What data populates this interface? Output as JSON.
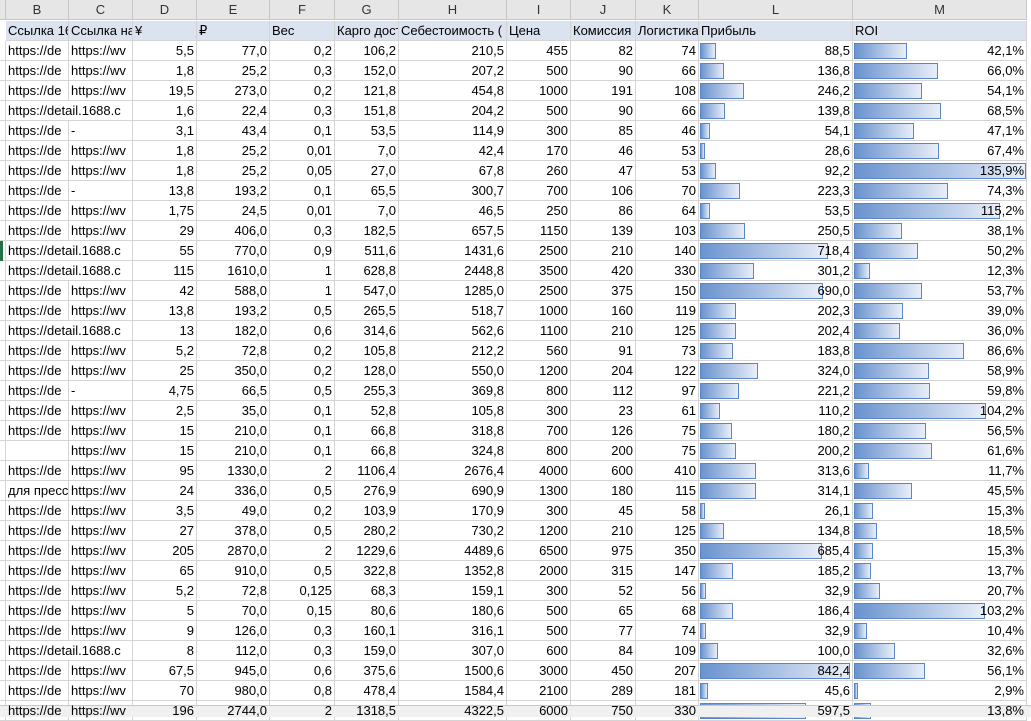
{
  "columns": [
    "B",
    "C",
    "D",
    "E",
    "F",
    "G",
    "H",
    "I",
    "J",
    "K",
    "L",
    "M"
  ],
  "headers": [
    "Ссылка 1688",
    "Ссылка на WB",
    "¥",
    "₽",
    "Вес",
    "Карго доставка",
    "Себестоимость (",
    "Цена",
    "Комиссия",
    "Логистика",
    "Прибыль",
    "ROI"
  ],
  "rows": [
    [
      "https://de",
      "https://wv",
      "5,5",
      "77,0",
      "0,2",
      "106,2",
      "210,5",
      "455",
      "82",
      "74",
      "88,5",
      "42,1%"
    ],
    [
      "https://de",
      "https://wv",
      "1,8",
      "25,2",
      "0,3",
      "152,0",
      "207,2",
      "500",
      "90",
      "66",
      "136,8",
      "66,0%"
    ],
    [
      "https://de",
      "https://wv",
      "19,5",
      "273,0",
      "0,2",
      "121,8",
      "454,8",
      "1000",
      "191",
      "108",
      "246,2",
      "54,1%"
    ],
    [
      "https://detail.1688.c",
      "",
      "1,6",
      "22,4",
      "0,3",
      "151,8",
      "204,2",
      "500",
      "90",
      "66",
      "139,8",
      "68,5%"
    ],
    [
      "https://de",
      "-",
      "3,1",
      "43,4",
      "0,1",
      "53,5",
      "114,9",
      "300",
      "85",
      "46",
      "54,1",
      "47,1%"
    ],
    [
      "https://de",
      "https://wv",
      "1,8",
      "25,2",
      "0,01",
      "7,0",
      "42,4",
      "170",
      "46",
      "53",
      "28,6",
      "67,4%"
    ],
    [
      "https://de",
      "https://wv",
      "1,8",
      "25,2",
      "0,05",
      "27,0",
      "67,8",
      "260",
      "47",
      "53",
      "92,2",
      "135,9%"
    ],
    [
      "https://de",
      "-",
      "13,8",
      "193,2",
      "0,1",
      "65,5",
      "300,7",
      "700",
      "106",
      "70",
      "223,3",
      "74,3%"
    ],
    [
      "https://de",
      "https://wv",
      "1,75",
      "24,5",
      "0,01",
      "7,0",
      "46,5",
      "250",
      "86",
      "64",
      "53,5",
      "115,2%"
    ],
    [
      "https://de",
      "https://wv",
      "29",
      "406,0",
      "0,3",
      "182,5",
      "657,5",
      "1150",
      "139",
      "103",
      "250,5",
      "38,1%"
    ],
    [
      "https://detail.1688.c",
      "",
      "55",
      "770,0",
      "0,9",
      "511,6",
      "1431,6",
      "2500",
      "210",
      "140",
      "718,4",
      "50,2%"
    ],
    [
      "https://detail.1688.c",
      "",
      "115",
      "1610,0",
      "1",
      "628,8",
      "2448,8",
      "3500",
      "420",
      "330",
      "301,2",
      "12,3%"
    ],
    [
      "https://de",
      "https://wv",
      "42",
      "588,0",
      "1",
      "547,0",
      "1285,0",
      "2500",
      "375",
      "150",
      "690,0",
      "53,7%"
    ],
    [
      "https://de",
      "https://wv",
      "13,8",
      "193,2",
      "0,5",
      "265,5",
      "518,7",
      "1000",
      "160",
      "119",
      "202,3",
      "39,0%"
    ],
    [
      "https://detail.1688.c",
      "",
      "13",
      "182,0",
      "0,6",
      "314,6",
      "562,6",
      "1100",
      "210",
      "125",
      "202,4",
      "36,0%"
    ],
    [
      "https://de",
      "https://wv",
      "5,2",
      "72,8",
      "0,2",
      "105,8",
      "212,2",
      "560",
      "91",
      "73",
      "183,8",
      "86,6%"
    ],
    [
      "https://de",
      "https://wv",
      "25",
      "350,0",
      "0,2",
      "128,0",
      "550,0",
      "1200",
      "204",
      "122",
      "324,0",
      "58,9%"
    ],
    [
      "https://de",
      "-",
      "4,75",
      "66,5",
      "0,5",
      "255,3",
      "369,8",
      "800",
      "112",
      "97",
      "221,2",
      "59,8%"
    ],
    [
      "https://de",
      "https://wv",
      "2,5",
      "35,0",
      "0,1",
      "52,8",
      "105,8",
      "300",
      "23",
      "61",
      "110,2",
      "104,2%"
    ],
    [
      "https://de",
      "https://wv",
      "15",
      "210,0",
      "0,1",
      "66,8",
      "318,8",
      "700",
      "126",
      "75",
      "180,2",
      "56,5%"
    ],
    [
      "",
      "https://wv",
      "15",
      "210,0",
      "0,1",
      "66,8",
      "324,8",
      "800",
      "200",
      "75",
      "200,2",
      "61,6%"
    ],
    [
      "https://de",
      "https://wv",
      "95",
      "1330,0",
      "2",
      "1106,4",
      "2676,4",
      "4000",
      "600",
      "410",
      "313,6",
      "11,7%"
    ],
    [
      "для пресса",
      "https://wv",
      "24",
      "336,0",
      "0,5",
      "276,9",
      "690,9",
      "1300",
      "180",
      "115",
      "314,1",
      "45,5%"
    ],
    [
      "https://de",
      "https://wv",
      "3,5",
      "49,0",
      "0,2",
      "103,9",
      "170,9",
      "300",
      "45",
      "58",
      "26,1",
      "15,3%"
    ],
    [
      "https://de",
      "https://wv",
      "27",
      "378,0",
      "0,5",
      "280,2",
      "730,2",
      "1200",
      "210",
      "125",
      "134,8",
      "18,5%"
    ],
    [
      "https://de",
      "https://wv",
      "205",
      "2870,0",
      "2",
      "1229,6",
      "4489,6",
      "6500",
      "975",
      "350",
      "685,4",
      "15,3%"
    ],
    [
      "https://de",
      "https://wv",
      "65",
      "910,0",
      "0,5",
      "322,8",
      "1352,8",
      "2000",
      "315",
      "147",
      "185,2",
      "13,7%"
    ],
    [
      "https://de",
      "https://wv",
      "5,2",
      "72,8",
      "0,125",
      "68,3",
      "159,1",
      "300",
      "52",
      "56",
      "32,9",
      "20,7%"
    ],
    [
      "https://de",
      "https://wv",
      "5",
      "70,0",
      "0,15",
      "80,6",
      "180,6",
      "500",
      "65",
      "68",
      "186,4",
      "103,2%"
    ],
    [
      "https://de",
      "https://wv",
      "9",
      "126,0",
      "0,3",
      "160,1",
      "316,1",
      "500",
      "77",
      "74",
      "32,9",
      "10,4%"
    ],
    [
      "https://detail.1688.c",
      "",
      "8",
      "112,0",
      "0,3",
      "159,0",
      "307,0",
      "600",
      "84",
      "109",
      "100,0",
      "32,6%"
    ],
    [
      "https://de",
      "https://wv",
      "67,5",
      "945,0",
      "0,6",
      "375,6",
      "1500,6",
      "3000",
      "450",
      "207",
      "842,4",
      "56,1%"
    ],
    [
      "https://de",
      "https://wv",
      "70",
      "980,0",
      "0,8",
      "478,4",
      "1584,4",
      "2100",
      "289",
      "181",
      "45,6",
      "2,9%"
    ],
    [
      "https://de",
      "https://wv",
      "196",
      "2744,0",
      "2",
      "1318,5",
      "4322,5",
      "6000",
      "750",
      "330",
      "597,5",
      "13,8%"
    ]
  ],
  "bar_color": "#5b86c6"
}
